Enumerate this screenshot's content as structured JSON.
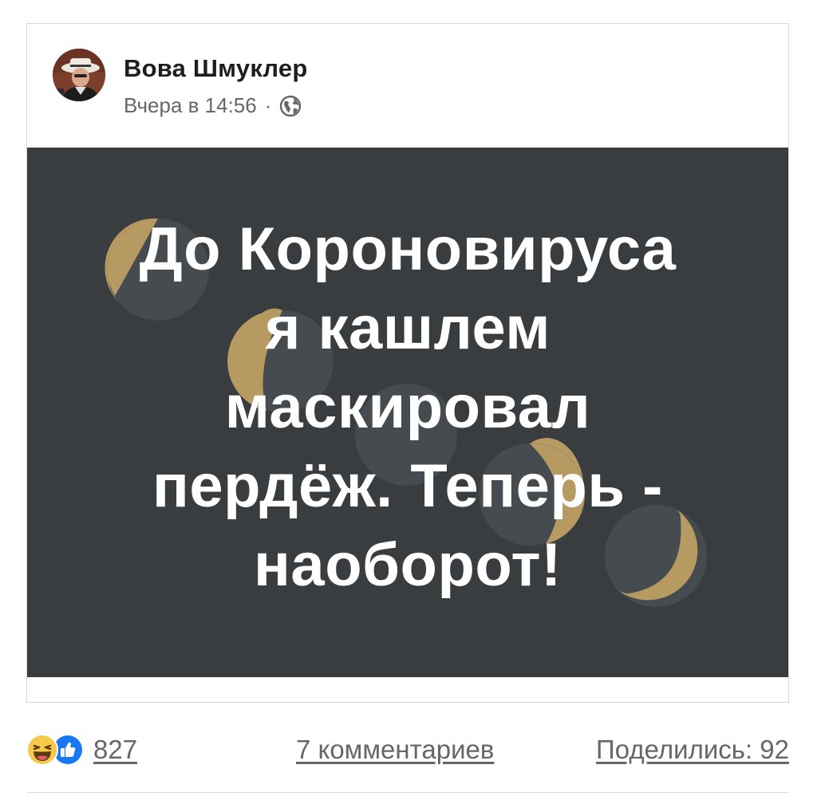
{
  "post": {
    "author": "Вова Шмуклер",
    "timestamp": "Вчера в 14:56",
    "separator": "·",
    "privacy_icon": "globe-icon",
    "image_text_lines": [
      "До Короновируса",
      "я кашлем",
      "маскировал",
      "пердёж. Теперь -",
      "наоборот!"
    ],
    "image_background": "#393d40",
    "moon_accent": "#b69a62"
  },
  "footer": {
    "reaction_icons": [
      "haha-reaction-icon",
      "like-reaction-icon"
    ],
    "reaction_count": "827",
    "comments": "7 комментариев",
    "shares": "Поделились: 92"
  }
}
